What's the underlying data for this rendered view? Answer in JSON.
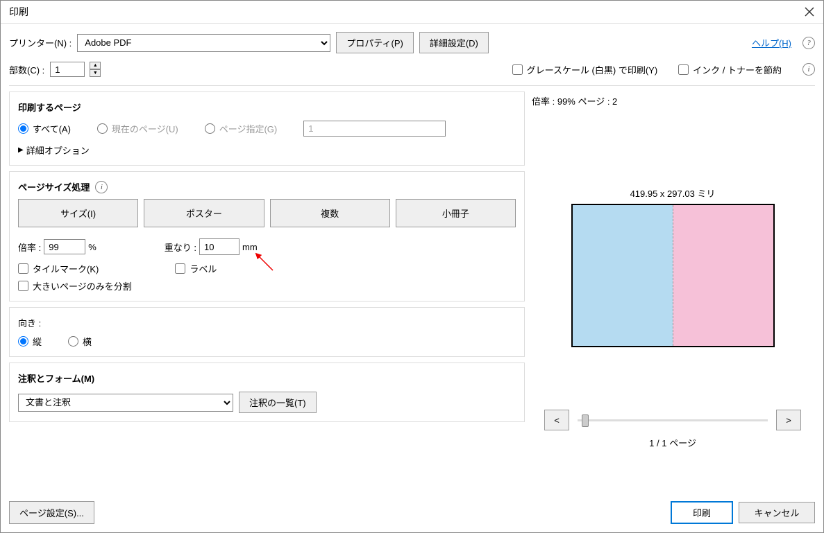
{
  "dialog": {
    "title": "印刷"
  },
  "printer": {
    "label": "プリンター(N) :",
    "selected": "Adobe PDF",
    "properties_btn": "プロパティ(P)",
    "advanced_btn": "詳細設定(D)"
  },
  "help": {
    "link": "ヘルプ(H)"
  },
  "copies": {
    "label": "部数(C) :",
    "value": "1"
  },
  "options": {
    "grayscale": "グレースケール (白黒) で印刷(Y)",
    "save_toner": "インク / トナーを節約"
  },
  "pages": {
    "title": "印刷するページ",
    "all": "すべて(A)",
    "current": "現在のページ(U)",
    "range": "ページ指定(G)",
    "range_placeholder": "1",
    "more": "詳細オプション"
  },
  "sizing": {
    "title": "ページサイズ処理",
    "size_btn": "サイズ(I)",
    "poster_btn": "ポスター",
    "multiple_btn": "複数",
    "booklet_btn": "小冊子",
    "scale_label": "倍率 :",
    "scale_value": "99",
    "scale_unit": "%",
    "overlap_label": "重なり :",
    "overlap_value": "10",
    "overlap_unit": "mm",
    "tile_marks": "タイルマーク(K)",
    "labels": "ラベル",
    "split_large": "大きいページのみを分割"
  },
  "orientation": {
    "title": "向き :",
    "portrait": "縦",
    "landscape": "横"
  },
  "comments": {
    "title": "注釈とフォーム(M)",
    "selected": "文書と注釈",
    "summary_btn": "注釈の一覧(T)"
  },
  "preview": {
    "header": "倍率 : 99% ページ : 2",
    "dimensions": "419.95 x 297.03 ミリ",
    "counter": "1 / 1 ページ",
    "prev": "<",
    "next": ">"
  },
  "footer": {
    "page_setup": "ページ設定(S)...",
    "print": "印刷",
    "cancel": "キャンセル"
  }
}
